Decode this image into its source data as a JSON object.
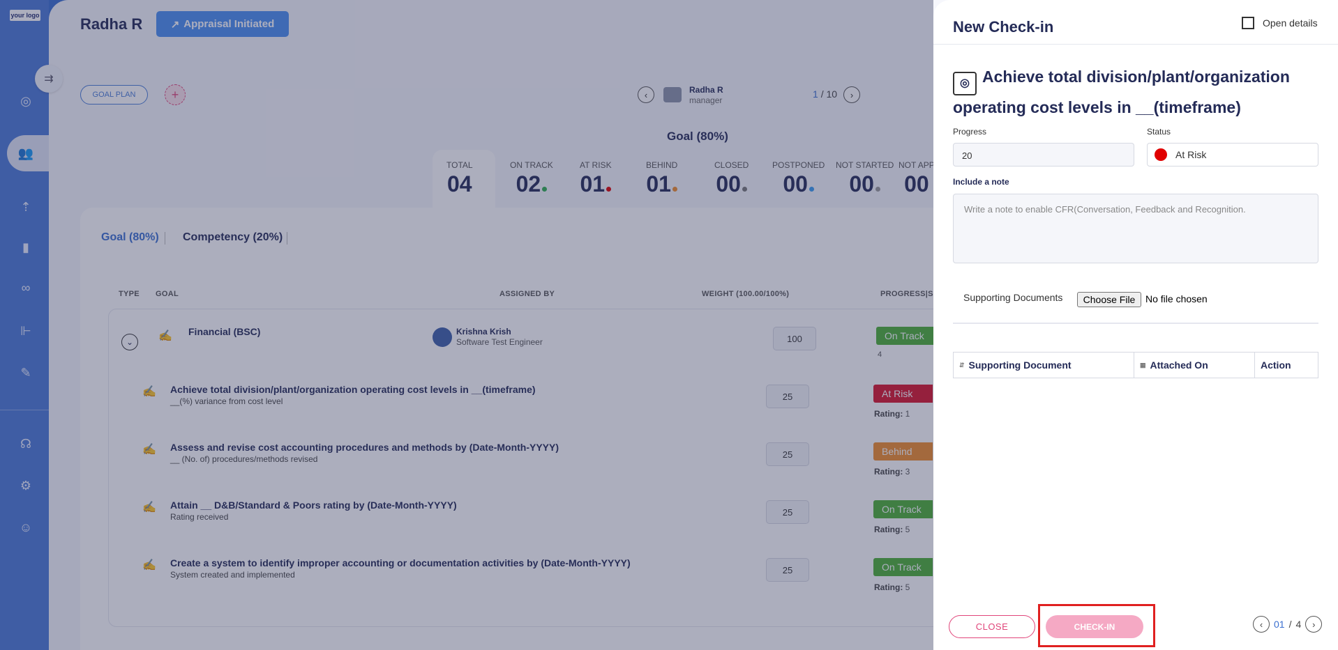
{
  "app": {
    "logo_text": "your logo"
  },
  "header": {
    "employee_name": "Radha R",
    "appraisal_status": "Appraisal Initiated",
    "goal_plan_label": "GOAL PLAN",
    "add_icon": "plus-icon"
  },
  "manager": {
    "name": "Radha R",
    "role": "manager"
  },
  "pager": {
    "current": "1",
    "separator": "/",
    "total": "10"
  },
  "goal_section_title": "Goal (80%)",
  "stats": [
    {
      "label": "TOTAL",
      "value": "04",
      "color": ""
    },
    {
      "label": "ON TRACK",
      "value": "02",
      "color": "#2eae4f"
    },
    {
      "label": "AT RISK",
      "value": "01",
      "color": "#e00000"
    },
    {
      "label": "BEHIND",
      "value": "01",
      "color": "#f08c2a"
    },
    {
      "label": "CLOSED",
      "value": "00",
      "color": "#777777"
    },
    {
      "label": "POSTPONED",
      "value": "00",
      "color": "#3a9cf0"
    },
    {
      "label": "NOT STARTED",
      "value": "00",
      "color": "#999999"
    },
    {
      "label": "NOT APP",
      "value": "00",
      "color": ""
    }
  ],
  "tabs": {
    "goal": "Goal (80%)",
    "competency": "Competency (20%)"
  },
  "table_headers": {
    "type": "TYPE",
    "goal": "GOAL",
    "assigned_by": "ASSIGNED BY",
    "weight": "WEIGHT (100.00/100%)",
    "progress": "PROGRESS|SC"
  },
  "category": {
    "title": "Financial (BSC)",
    "assigned_by_name": "Krishna Krish",
    "assigned_by_role": "Software Test Engineer",
    "weight": "100",
    "status": "On Track",
    "progress_value": "4"
  },
  "goals": [
    {
      "title": "Achieve total division/plant/organization operating cost levels in __(timeframe)",
      "sub": "__(%) variance from cost level",
      "weight": "25",
      "status": "At Risk",
      "status_color": "#d9132b",
      "rating_label": "Rating:",
      "rating": "1"
    },
    {
      "title": "Assess and revise cost accounting procedures and methods by (Date-Month-YYYY)",
      "sub": "__ (No. of) procedures/methods revised",
      "weight": "25",
      "status": "Behind",
      "status_color": "#f08c2a",
      "rating_label": "Rating:",
      "rating": "3"
    },
    {
      "title": "Attain __ D&B/Standard & Poors rating by (Date-Month-YYYY)",
      "sub": "Rating received",
      "weight": "25",
      "status": "On Track",
      "status_color": "#4cb035",
      "rating_label": "Rating:",
      "rating": "5"
    },
    {
      "title": "Create a system to identify improper accounting or documentation activities by (Date-Month-YYYY)",
      "sub": "System created and implemented",
      "weight": "25",
      "status": "On Track",
      "status_color": "#4cb035",
      "rating_label": "Rating:",
      "rating": "5"
    }
  ],
  "drawer": {
    "title": "New Check-in",
    "open_details": "Open details",
    "goal_title": "Achieve total division/plant/organization operating cost levels in __(timeframe)",
    "progress_label": "Progress",
    "progress_value": "20",
    "status_label": "Status",
    "status_value": "At Risk",
    "note_label": "Include a note",
    "note_placeholder": "Write a note to enable CFR(Conversation, Feedback and Recognition.",
    "supporting_docs_label": "Supporting Documents",
    "choose_file": "Choose File",
    "no_file": "No file chosen",
    "doc_columns": [
      "Supporting Document",
      "Attached On",
      "Action"
    ],
    "close_label": "CLOSE",
    "checkin_label": "CHECK-IN",
    "pager_current": "01",
    "pager_sep": "/",
    "pager_total": "4"
  }
}
